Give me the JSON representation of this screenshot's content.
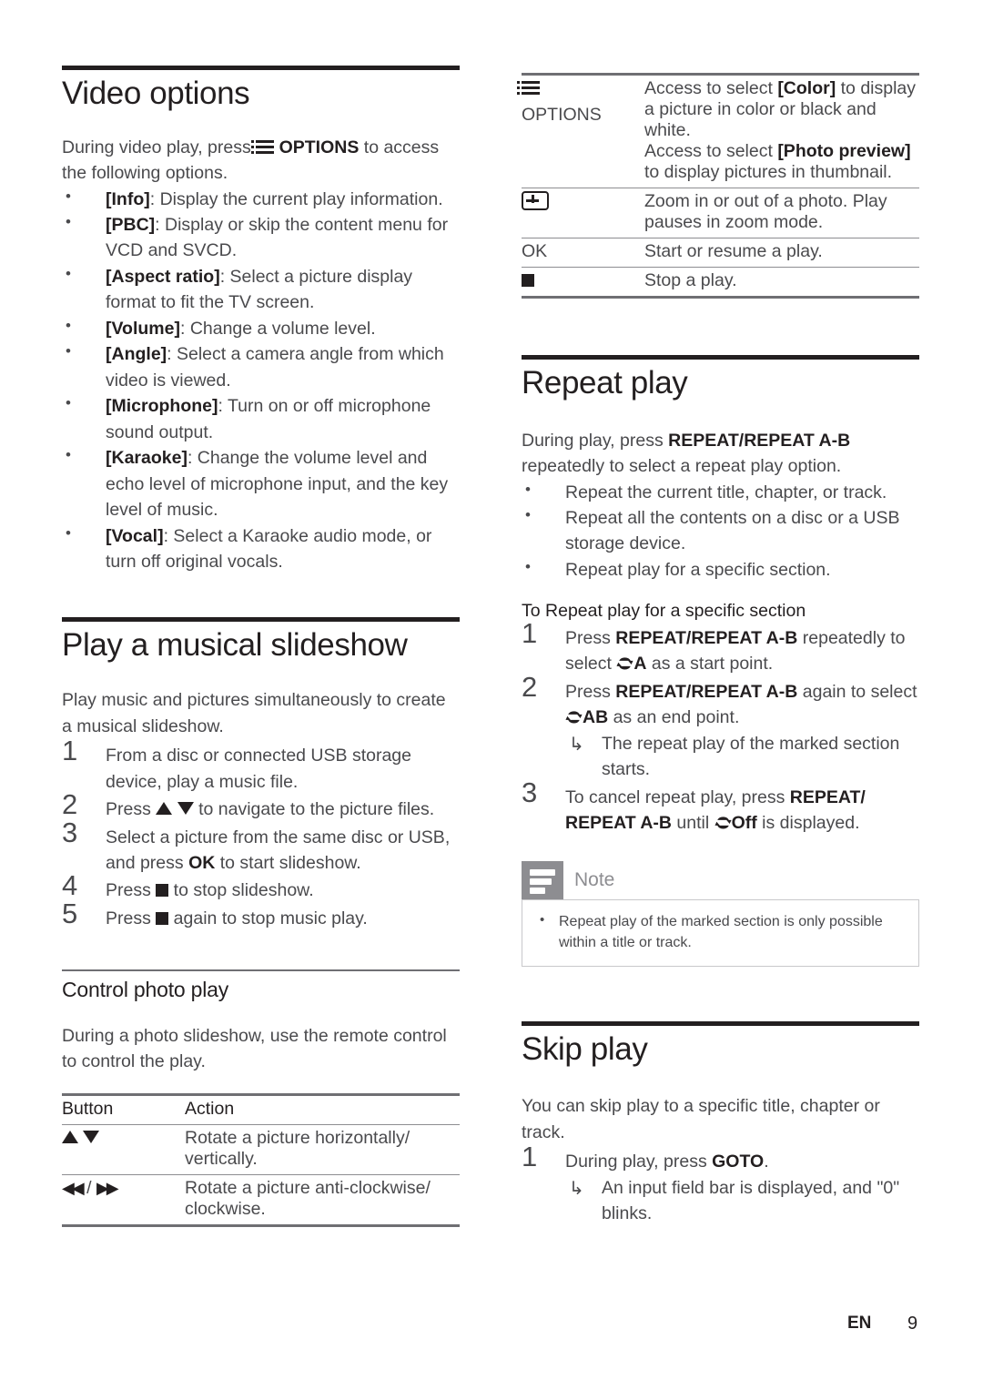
{
  "footer": {
    "language": "EN",
    "page": "9"
  },
  "left_column": {
    "section1": {
      "title": "Video options",
      "intro_part1": "During video play, press ",
      "intro_options_label": "OPTIONS",
      "intro_part2": " to access the following options.",
      "bullets": [
        {
          "term": "[Info]",
          "text": ": Display the current play information."
        },
        {
          "term": "[PBC]",
          "text": ": Display or skip the content menu for VCD and SVCD."
        },
        {
          "term": "[Aspect ratio]",
          "text": ": Select a picture display format to fit the TV screen."
        },
        {
          "term": "[Volume]",
          "text": ": Change a volume level."
        },
        {
          "term": "[Angle]",
          "text": ": Select a camera angle from which video is viewed."
        },
        {
          "term": "[Microphone]",
          "text": ": Turn on or off microphone sound output."
        },
        {
          "term": "[Karaoke]",
          "text": ": Change the volume level and echo level of microphone input, and the key level of music."
        },
        {
          "term": "[Vocal]",
          "text": ": Select a Karaoke audio mode, or turn off original vocals."
        }
      ]
    },
    "section2": {
      "title": "Play a musical slideshow",
      "intro": "Play music and pictures simultaneously to create a musical slideshow.",
      "steps": [
        {
          "num": "1",
          "text": "From a disc or connected USB storage device, play a music file."
        },
        {
          "num": "2",
          "pre": "Press ",
          "post": " to navigate to the picture files."
        },
        {
          "num": "3",
          "pre": "Select a picture from the same disc or USB, and press ",
          "bold": "OK",
          "post": " to start slideshow."
        },
        {
          "num": "4",
          "pre": "Press ",
          "post": " to stop slideshow."
        },
        {
          "num": "5",
          "pre": "Press ",
          "post": " again to stop music play."
        }
      ]
    },
    "section3": {
      "title": "Control photo play",
      "intro": "During a photo slideshow, use the remote control to control the play.",
      "table": {
        "headers": [
          "Button",
          "Action"
        ],
        "rows": [
          {
            "button_icons": "up-down-arrows",
            "action": "Rotate a picture horizontally/ vertically."
          },
          {
            "button_icons": "rewind-forward",
            "action": "Rotate a picture anti-clockwise/ clockwise."
          }
        ]
      }
    }
  },
  "right_column": {
    "options_table": {
      "rows": [
        {
          "key_icon": "options-list-icon",
          "key_label": "OPTIONS",
          "lines": [
            {
              "pre": "Access to select ",
              "bold": "[Color]",
              "post": " to display a picture in color or black and white."
            },
            {
              "pre": "Access to select ",
              "bold": "[Photo preview]",
              "post": " to display pictures in thumbnail."
            }
          ]
        },
        {
          "key_icon": "zoom-icon",
          "action": "Zoom in or out of a photo. Play pauses in zoom mode."
        },
        {
          "key_label": "OK",
          "action": "Start or resume a play."
        },
        {
          "key_icon": "stop-icon",
          "action": "Stop a play."
        }
      ]
    },
    "section_repeat": {
      "title": "Repeat play",
      "intro_pre": "During play, press ",
      "intro_bold": "REPEAT/REPEAT A-B",
      "intro_post": " repeatedly to select a repeat play option.",
      "bullets": [
        "Repeat the current title, chapter, or track.",
        "Repeat all the contents on a disc or a USB storage device.",
        "Repeat play for a specific section."
      ],
      "subheading": "To Repeat play for a specific section",
      "steps": [
        {
          "num": "1",
          "pre": "Press ",
          "bold": "REPEAT/REPEAT A-B",
          "mid": " repeatedly to select ",
          "marker": "A",
          "post": " as a start point."
        },
        {
          "num": "2",
          "pre": "Press ",
          "bold": "REPEAT/REPEAT A-B",
          "mid": " again to select ",
          "marker": "AB",
          "post": " as an end point.",
          "sub": "The repeat play of the marked section starts."
        },
        {
          "num": "3",
          "pre": "To cancel repeat play, press ",
          "bold": "REPEAT/ REPEAT A-B",
          "mid": " until ",
          "marker": "Off",
          "post": " is displayed."
        }
      ],
      "note": {
        "label": "Note",
        "items": [
          "Repeat play of the marked section is only possible within a title or track."
        ]
      }
    },
    "section_skip": {
      "title": "Skip play",
      "intro": "You can skip play to a specific title, chapter or track.",
      "steps": [
        {
          "num": "1",
          "pre": "During play, press ",
          "bold": "GOTO",
          "post": ".",
          "sub": "An input field bar is displayed, and \"0\" blinks."
        }
      ]
    }
  }
}
